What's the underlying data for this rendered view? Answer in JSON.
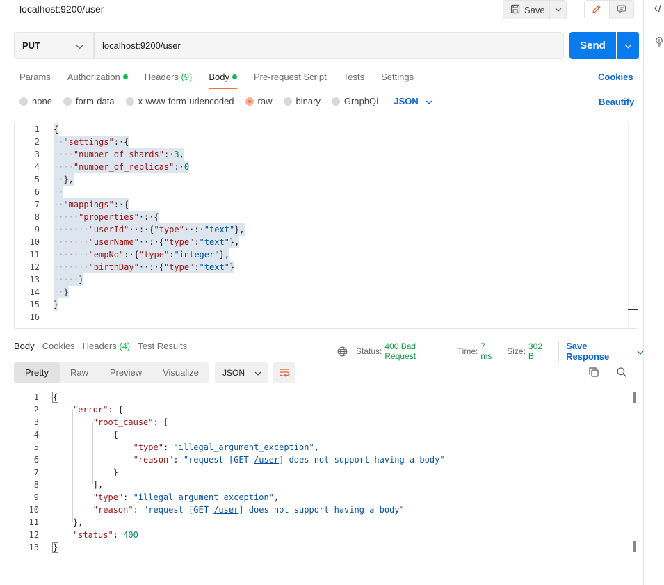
{
  "request": {
    "title": "localhost:9200/user",
    "save_label": "Save",
    "method": "PUT",
    "url": "localhost:9200/user",
    "send_label": "Send",
    "tabs": [
      {
        "label": "Params",
        "dot": false,
        "count": ""
      },
      {
        "label": "Authorization",
        "dot": true,
        "count": ""
      },
      {
        "label": "Headers",
        "dot": false,
        "count": "(9)"
      },
      {
        "label": "Body",
        "dot": true,
        "count": "",
        "active": true
      },
      {
        "label": "Pre-request Script",
        "dot": false,
        "count": ""
      },
      {
        "label": "Tests",
        "dot": false,
        "count": ""
      },
      {
        "label": "Settings",
        "dot": false,
        "count": ""
      }
    ],
    "cookies_label": "Cookies",
    "body_types": [
      "none",
      "form-data",
      "x-www-form-urlencoded",
      "raw",
      "binary",
      "GraphQL"
    ],
    "body_type_selected": "raw",
    "body_lang": "JSON",
    "beautify_label": "Beautify",
    "line_numbers": [
      "1",
      "2",
      "3",
      "4",
      "5",
      "6",
      "7",
      "8",
      "9",
      "10",
      "11",
      "12",
      "13",
      "14",
      "15",
      "16"
    ]
  },
  "response": {
    "tabs": [
      {
        "label": "Body",
        "count": "",
        "active": true
      },
      {
        "label": "Cookies",
        "count": ""
      },
      {
        "label": "Headers",
        "count": "(4)"
      },
      {
        "label": "Test Results",
        "count": ""
      }
    ],
    "status_label": "Status:",
    "status_value": "400 Bad Request",
    "time_label": "Time:",
    "time_value": "7 ms",
    "size_label": "Size:",
    "size_value": "302 B",
    "save_response_label": "Save Response",
    "view_tabs": [
      "Pretty",
      "Raw",
      "Preview",
      "Visualize"
    ],
    "view_active": "Pretty",
    "lang": "JSON",
    "line_numbers": [
      "1",
      "2",
      "3",
      "4",
      "5",
      "6",
      "7",
      "8",
      "9",
      "10",
      "11",
      "12",
      "13"
    ]
  },
  "icons": {
    "save": "floppy-icon",
    "edit": "pencil-icon",
    "comments": "comment-icon",
    "code": "code-icon",
    "bulb": "bulb-icon",
    "globe": "globe-icon",
    "wrap": "wrap-lines-icon",
    "copy": "copy-icon",
    "search": "search-icon"
  },
  "colors": {
    "accent": "#ff6c37",
    "send": "#097bed",
    "link": "#0b68d4",
    "success": "#0cbb52"
  }
}
